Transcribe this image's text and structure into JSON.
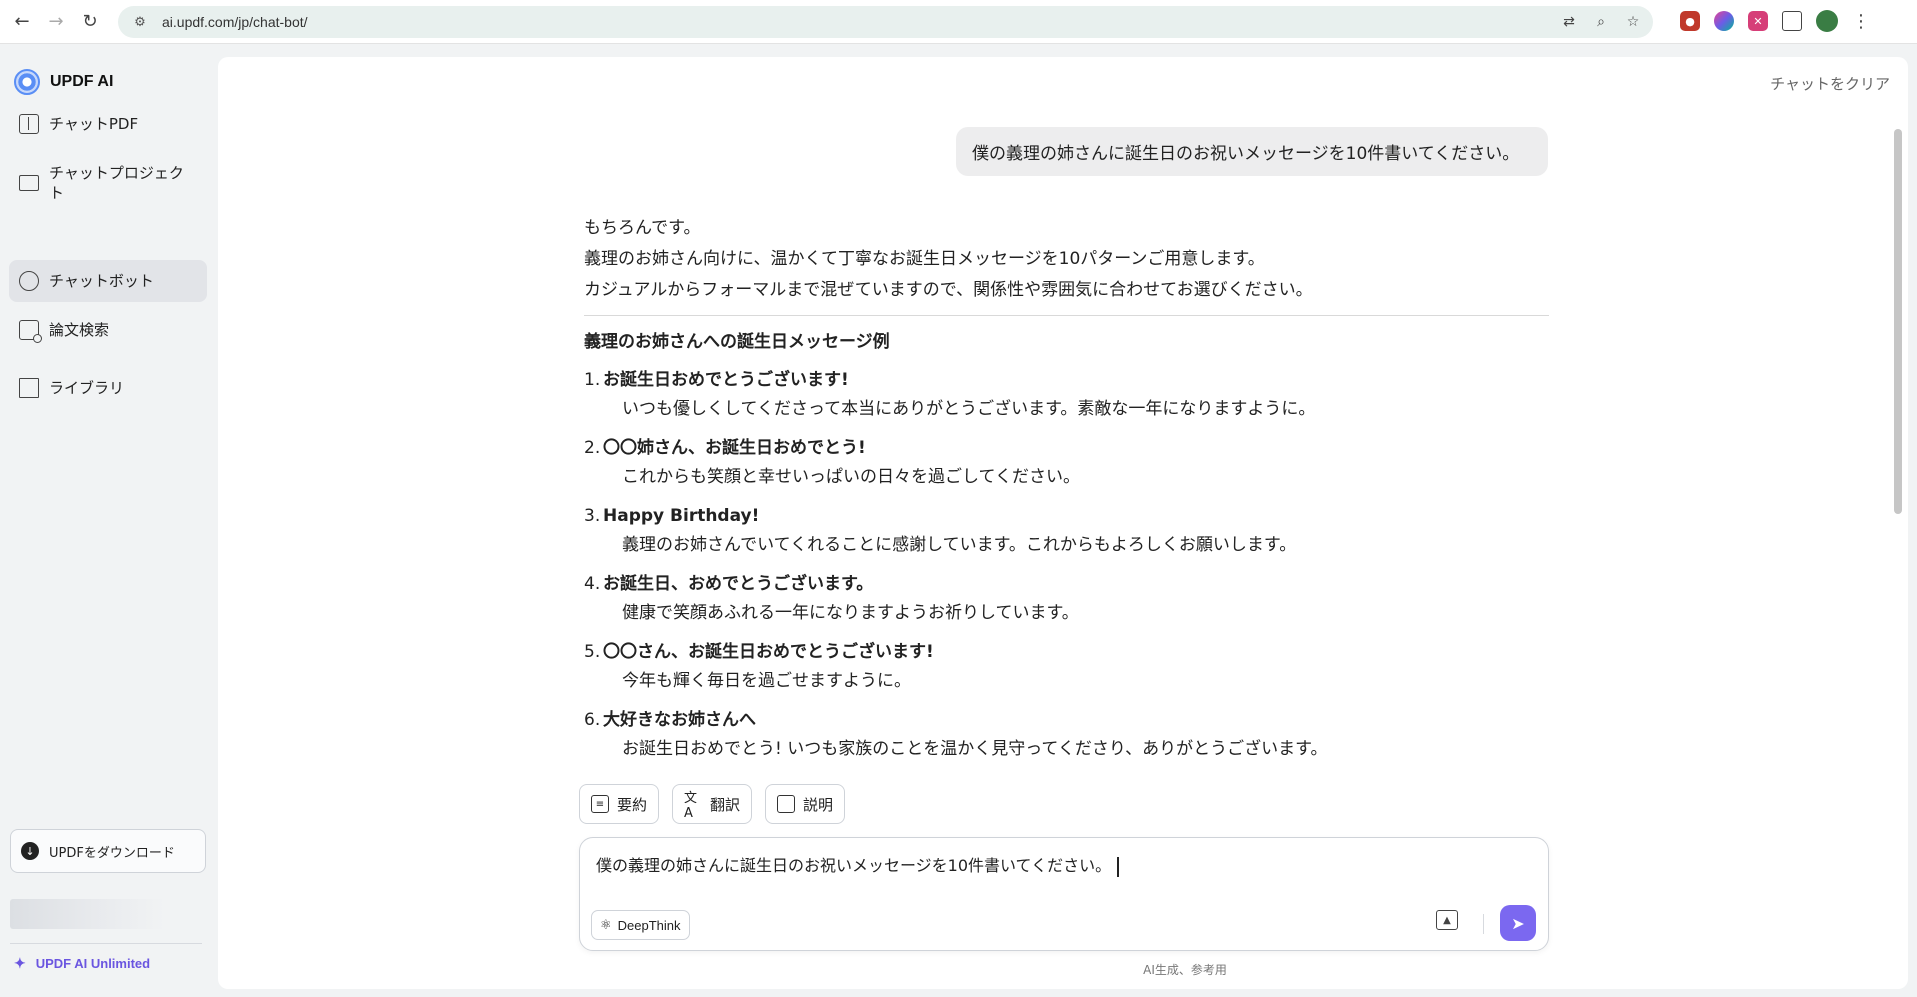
{
  "browser": {
    "url": "ai.updf.com/jp/chat-bot/"
  },
  "sidebar": {
    "brand": "UPDF AI",
    "items": [
      {
        "label": "チャットPDF"
      },
      {
        "label": "チャットプロジェクト"
      },
      {
        "label": "チャットボット"
      },
      {
        "label": "論文検索"
      },
      {
        "label": "ライブラリ"
      }
    ],
    "download_label": "UPDFをダウンロード",
    "unlimited_label": "UPDF AI Unlimited"
  },
  "main": {
    "clear_label": "チャットをクリア",
    "user_message": "僕の義理の姉さんに誕生日のお祝いメッセージを10件書いてください。",
    "answer": {
      "intro": [
        "もちろんです。",
        "義理のお姉さん向けに、温かくて丁寧なお誕生日メッセージを10パターンご用意します。",
        "カジュアルからフォーマルまで混ぜていますので、関係性や雰囲気に合わせてお選びください。"
      ],
      "heading": "義理のお姉さんへの誕生日メッセージ例",
      "items": [
        {
          "num": "1.",
          "title": "お誕生日おめでとうございます!",
          "desc": "いつも優しくしてくださって本当にありがとうございます。素敵な一年になりますように。"
        },
        {
          "num": "2.",
          "title": "〇〇姉さん、お誕生日おめでとう!",
          "desc": "これからも笑顔と幸せいっぱいの日々を過ごしてください。"
        },
        {
          "num": "3.",
          "title": "Happy Birthday!",
          "desc": "義理のお姉さんでいてくれることに感謝しています。これからもよろしくお願いします。"
        },
        {
          "num": "4.",
          "title": "お誕生日、おめでとうございます。",
          "desc": "健康で笑顔あふれる一年になりますようお祈りしています。"
        },
        {
          "num": "5.",
          "title": "〇〇さん、お誕生日おめでとうございます!",
          "desc": "今年も輝く毎日を過ごせますように。"
        },
        {
          "num": "6.",
          "title": "大好きなお姉さんへ",
          "desc": "お誕生日おめでとう! いつも家族のことを温かく見守ってくださり、ありがとうございます。"
        }
      ]
    },
    "actions": {
      "summary": "要約",
      "translate": "翻訳",
      "explain": "説明"
    },
    "composer": {
      "value": "僕の義理の姉さんに誕生日のお祝いメッセージを10件書いてください。",
      "deepthink_label": "DeepThink"
    },
    "footnote": "AI生成、参考用"
  },
  "colors": {
    "accent": "#7b68f0",
    "unlimited": "#6a55e0"
  }
}
